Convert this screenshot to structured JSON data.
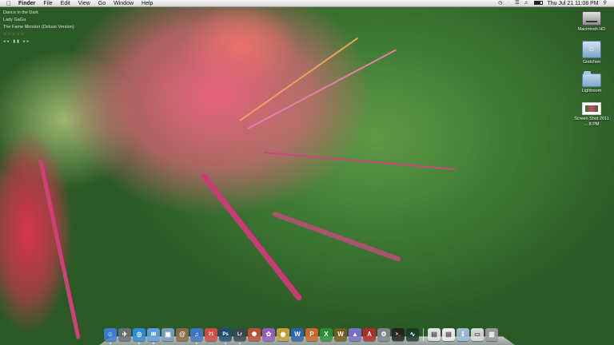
{
  "menubar": {
    "app_name": "Finder",
    "menus": [
      "File",
      "Edit",
      "View",
      "Go",
      "Window",
      "Help"
    ],
    "clock": "Thu Jul 21  11:08 PM",
    "battery_level": 0.8
  },
  "now_playing": {
    "track": "Dance in the Dark",
    "artist": "Lady GaGa",
    "album": "The Fame Monster (Deluxe Version)",
    "rating_stars": "☆☆☆☆☆",
    "controls": "◂◂ ▮▮ ▸▸"
  },
  "desktop": {
    "icons": [
      {
        "label": "Macintosh HD",
        "icon": "hard-drive-icon"
      },
      {
        "label": "Gretchen",
        "icon": "home-folder-icon"
      },
      {
        "label": "Lightroom",
        "icon": "folder-icon"
      },
      {
        "label": "Screen Shot 2011 ... 8 PM",
        "icon": "screenshot-file-icon"
      }
    ]
  },
  "dock": {
    "apps": [
      {
        "name": "finder",
        "glyph": "☺",
        "color": "#3b7fd9"
      },
      {
        "name": "launchpad",
        "glyph": "✈",
        "color": "#6a6f7a"
      },
      {
        "name": "safari",
        "glyph": "◎",
        "color": "#2a8fe0"
      },
      {
        "name": "mail",
        "glyph": "✉",
        "color": "#5da0e8"
      },
      {
        "name": "preview",
        "glyph": "▣",
        "color": "#7a9fc4"
      },
      {
        "name": "address-book",
        "glyph": "@",
        "color": "#8b6b4a"
      },
      {
        "name": "itunes",
        "glyph": "♫",
        "color": "#3d78c9"
      },
      {
        "name": "ical",
        "glyph": "21",
        "color": "#d94848"
      },
      {
        "name": "photoshop",
        "glyph": "Ps",
        "color": "#1e4d78"
      },
      {
        "name": "lightroom",
        "glyph": "Lr",
        "color": "#3a4552"
      },
      {
        "name": "pinwheel",
        "glyph": "✺",
        "color": "#c0503a"
      },
      {
        "name": "messenger",
        "glyph": "✿",
        "color": "#9a5cc4"
      },
      {
        "name": "aperture",
        "glyph": "◉",
        "color": "#c9a03a"
      },
      {
        "name": "word",
        "glyph": "W",
        "color": "#2d62b3"
      },
      {
        "name": "powerpoint",
        "glyph": "P",
        "color": "#d4682a"
      },
      {
        "name": "excel",
        "glyph": "X",
        "color": "#2e8f3e"
      },
      {
        "name": "warcraft",
        "glyph": "W",
        "color": "#7a5a1e"
      },
      {
        "name": "app-store",
        "glyph": "▲",
        "color": "#7a6fd0"
      },
      {
        "name": "acrobat",
        "glyph": "A",
        "color": "#b42a2a"
      },
      {
        "name": "system-preferences",
        "glyph": "⚙",
        "color": "#808890"
      },
      {
        "name": "terminal",
        "glyph": ">_",
        "color": "#222222"
      },
      {
        "name": "activity-monitor",
        "glyph": "∿",
        "color": "#1a3a2a"
      }
    ],
    "docs": [
      {
        "name": "document-stack",
        "glyph": "▤",
        "color": "#e8e8e8"
      },
      {
        "name": "document-file",
        "glyph": "▤",
        "color": "#f2f2f2"
      },
      {
        "name": "downloads-stack",
        "glyph": "⇩",
        "color": "#9ebedc"
      },
      {
        "name": "mail-stack",
        "glyph": "▭",
        "color": "#dcdcdc"
      },
      {
        "name": "trash",
        "glyph": "▥",
        "color": "#9a9a9a"
      }
    ],
    "running": [
      0,
      2,
      3,
      6,
      8,
      9
    ]
  }
}
